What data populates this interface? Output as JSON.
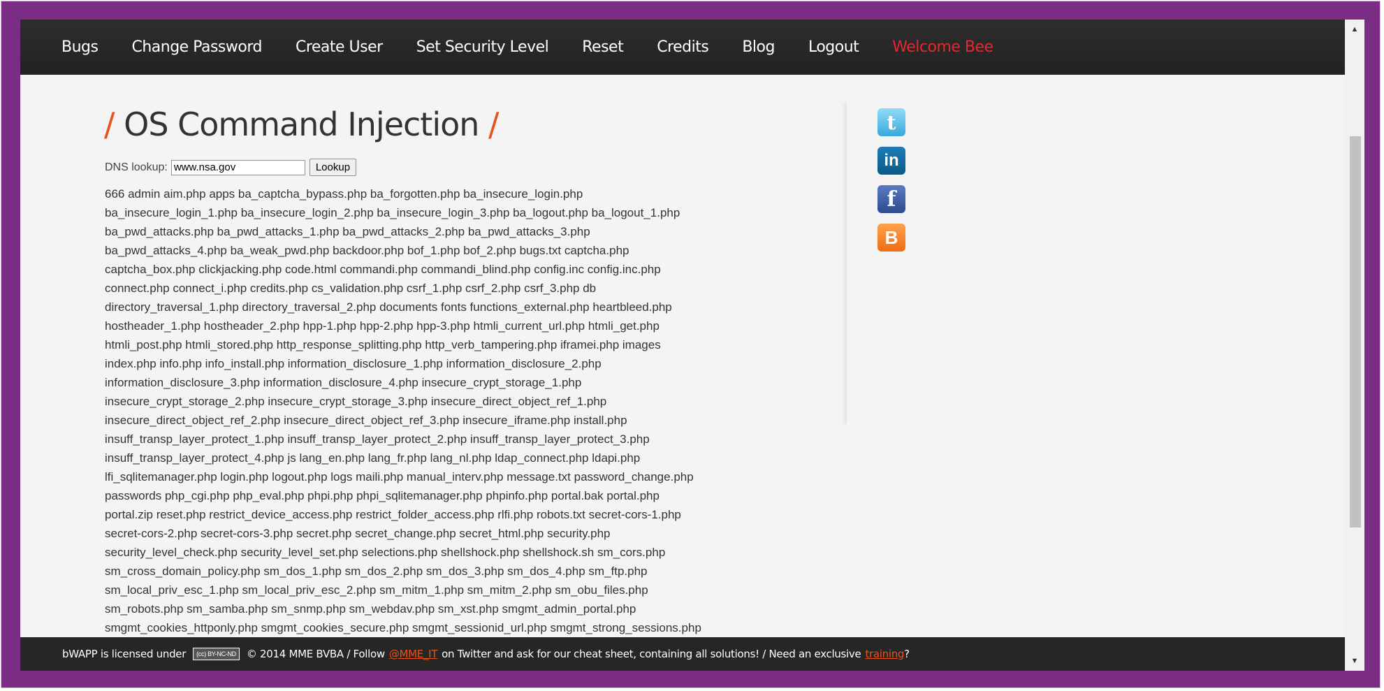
{
  "nav": {
    "items": [
      "Bugs",
      "Change Password",
      "Create User",
      "Set Security Level",
      "Reset",
      "Credits",
      "Blog",
      "Logout"
    ],
    "welcome": "Welcome Bee"
  },
  "page": {
    "title": "OS Command Injection",
    "slash_left": "/",
    "slash_right": "/"
  },
  "form": {
    "label": "DNS lookup:",
    "value": "www.nsa.gov",
    "button": "Lookup"
  },
  "output_lines": [
    "666 admin aim.php apps ba_captcha_bypass.php ba_forgotten.php ba_insecure_login.php",
    "ba_insecure_login_1.php ba_insecure_login_2.php ba_insecure_login_3.php ba_logout.php ba_logout_1.php",
    "ba_pwd_attacks.php ba_pwd_attacks_1.php ba_pwd_attacks_2.php ba_pwd_attacks_3.php",
    "ba_pwd_attacks_4.php ba_weak_pwd.php backdoor.php bof_1.php bof_2.php bugs.txt captcha.php",
    "captcha_box.php clickjacking.php code.html commandi.php commandi_blind.php config.inc config.inc.php",
    "connect.php connect_i.php credits.php cs_validation.php csrf_1.php csrf_2.php csrf_3.php db",
    "directory_traversal_1.php directory_traversal_2.php documents fonts functions_external.php heartbleed.php",
    "hostheader_1.php hostheader_2.php hpp-1.php hpp-2.php hpp-3.php htmli_current_url.php htmli_get.php",
    "htmli_post.php htmli_stored.php http_response_splitting.php http_verb_tampering.php iframei.php images",
    "index.php info.php info_install.php information_disclosure_1.php information_disclosure_2.php",
    "information_disclosure_3.php information_disclosure_4.php insecure_crypt_storage_1.php",
    "insecure_crypt_storage_2.php insecure_crypt_storage_3.php insecure_direct_object_ref_1.php",
    "insecure_direct_object_ref_2.php insecure_direct_object_ref_3.php insecure_iframe.php install.php",
    "insuff_transp_layer_protect_1.php insuff_transp_layer_protect_2.php insuff_transp_layer_protect_3.php",
    "insuff_transp_layer_protect_4.php js lang_en.php lang_fr.php lang_nl.php ldap_connect.php ldapi.php",
    "lfi_sqlitemanager.php login.php logout.php logs maili.php manual_interv.php message.txt password_change.php",
    "passwords php_cgi.php php_eval.php phpi.php phpi_sqlitemanager.php phpinfo.php portal.bak portal.php",
    "portal.zip reset.php restrict_device_access.php restrict_folder_access.php rlfi.php robots.txt secret-cors-1.php",
    "secret-cors-2.php secret-cors-3.php secret.php secret_change.php secret_html.php security.php",
    "security_level_check.php security_level_set.php selections.php shellshock.php shellshock.sh sm_cors.php",
    "sm_cross_domain_policy.php sm_dos_1.php sm_dos_2.php sm_dos_3.php sm_dos_4.php sm_ftp.php",
    "sm_local_priv_esc_1.php sm_local_priv_esc_2.php sm_mitm_1.php sm_mitm_2.php sm_obu_files.php",
    "sm_robots.php sm_samba.php sm_snmp.php sm_webdav.php sm_xst.php smgmt_admin_portal.php",
    "smgmt_cookies_httponly.php smgmt_cookies_secure.php smgmt_sessionid_url.php smgmt_strong_sessions.php"
  ],
  "social": {
    "twitter": "t",
    "linkedin": "in",
    "facebook": "f",
    "blogger": "B"
  },
  "footer": {
    "text1": "bWAPP is licensed under",
    "cc_badge": "(cc) BY-NC-ND",
    "text2": "© 2014 MME BVBA / Follow",
    "twitter_link": "@MME_IT",
    "text3": "on Twitter and ask for our cheat sheet, containing all solutions! / Need an exclusive",
    "training_link": "training",
    "text4": "?"
  },
  "scrollbar": {
    "up": "▲",
    "down": "▼"
  },
  "colors": {
    "frame": "#7b2d83",
    "navbar": "#262626",
    "accent": "#e8521b",
    "welcome": "#e8262d"
  }
}
